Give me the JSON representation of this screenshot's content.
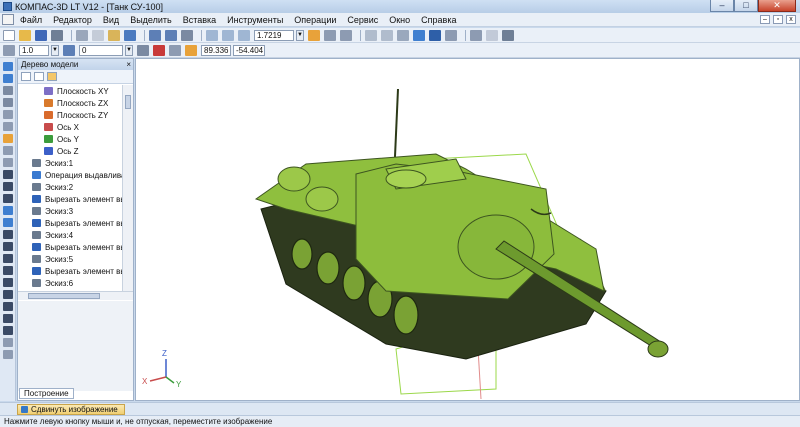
{
  "window": {
    "title": "КОМПАС-3D LT V12 - [Танк СУ-100]",
    "buttons": [
      "–",
      "□",
      "✕"
    ]
  },
  "menu": [
    "Файл",
    "Редактор",
    "Вид",
    "Выделить",
    "Вставка",
    "Инструменты",
    "Операции",
    "Сервис",
    "Окно",
    "Справка"
  ],
  "toolbar": {
    "zoom_value": "1.7219",
    "line_width": "1.0",
    "layer": "0",
    "coord_x": "89.336",
    "coord_y": "-54.404"
  },
  "tree_panel": {
    "title": "Дерево модели",
    "items": [
      {
        "label": "Плоскость XY",
        "indent": 2,
        "icon_color": "#7d6fc6"
      },
      {
        "label": "Плоскость ZX",
        "indent": 2,
        "icon_color": "#d97a2c"
      },
      {
        "label": "Плоскость ZY",
        "indent": 2,
        "icon_color": "#d96b2c"
      },
      {
        "label": "Ось X",
        "indent": 2,
        "icon_color": "#c84c4c"
      },
      {
        "label": "Ось Y",
        "indent": 2,
        "icon_color": "#3c9c3c"
      },
      {
        "label": "Ось Z",
        "indent": 2,
        "icon_color": "#3c5fc8"
      },
      {
        "label": "Эскиз:1",
        "indent": 1,
        "icon_color": "#6a7a8e"
      },
      {
        "label": "Операция выдавлива",
        "indent": 1,
        "icon_color": "#3a7ad0"
      },
      {
        "label": "Эскиз:2",
        "indent": 1,
        "icon_color": "#6a7a8e"
      },
      {
        "label": "Вырезать элемент вы",
        "indent": 1,
        "icon_color": "#2e62b8"
      },
      {
        "label": "Эскиз:3",
        "indent": 1,
        "icon_color": "#6a7a8e"
      },
      {
        "label": "Вырезать элемент вы",
        "indent": 1,
        "icon_color": "#2e62b8"
      },
      {
        "label": "Эскиз:4",
        "indent": 1,
        "icon_color": "#6a7a8e"
      },
      {
        "label": "Вырезать элемент вы",
        "indent": 1,
        "icon_color": "#2e62b8"
      },
      {
        "label": "Эскиз:5",
        "indent": 1,
        "icon_color": "#6a7a8e"
      },
      {
        "label": "Вырезать элемент вы",
        "indent": 1,
        "icon_color": "#2e62b8"
      },
      {
        "label": "Эскиз:6",
        "indent": 1,
        "icon_color": "#6a7a8e"
      }
    ],
    "tab_label": "Построение"
  },
  "triad": {
    "x": "X",
    "y": "Y",
    "z": "Z"
  },
  "command": {
    "label": "Сдвинуть изображение"
  },
  "status": {
    "text": "Нажмите левую кнопку мыши и, не отпуская, переместите изображение"
  },
  "colors": {
    "tank_body": "#8fbf3e",
    "tank_dark": "#2f3a1f",
    "selection_frame": "#9bd84a",
    "accent": "#3a6fb7"
  }
}
